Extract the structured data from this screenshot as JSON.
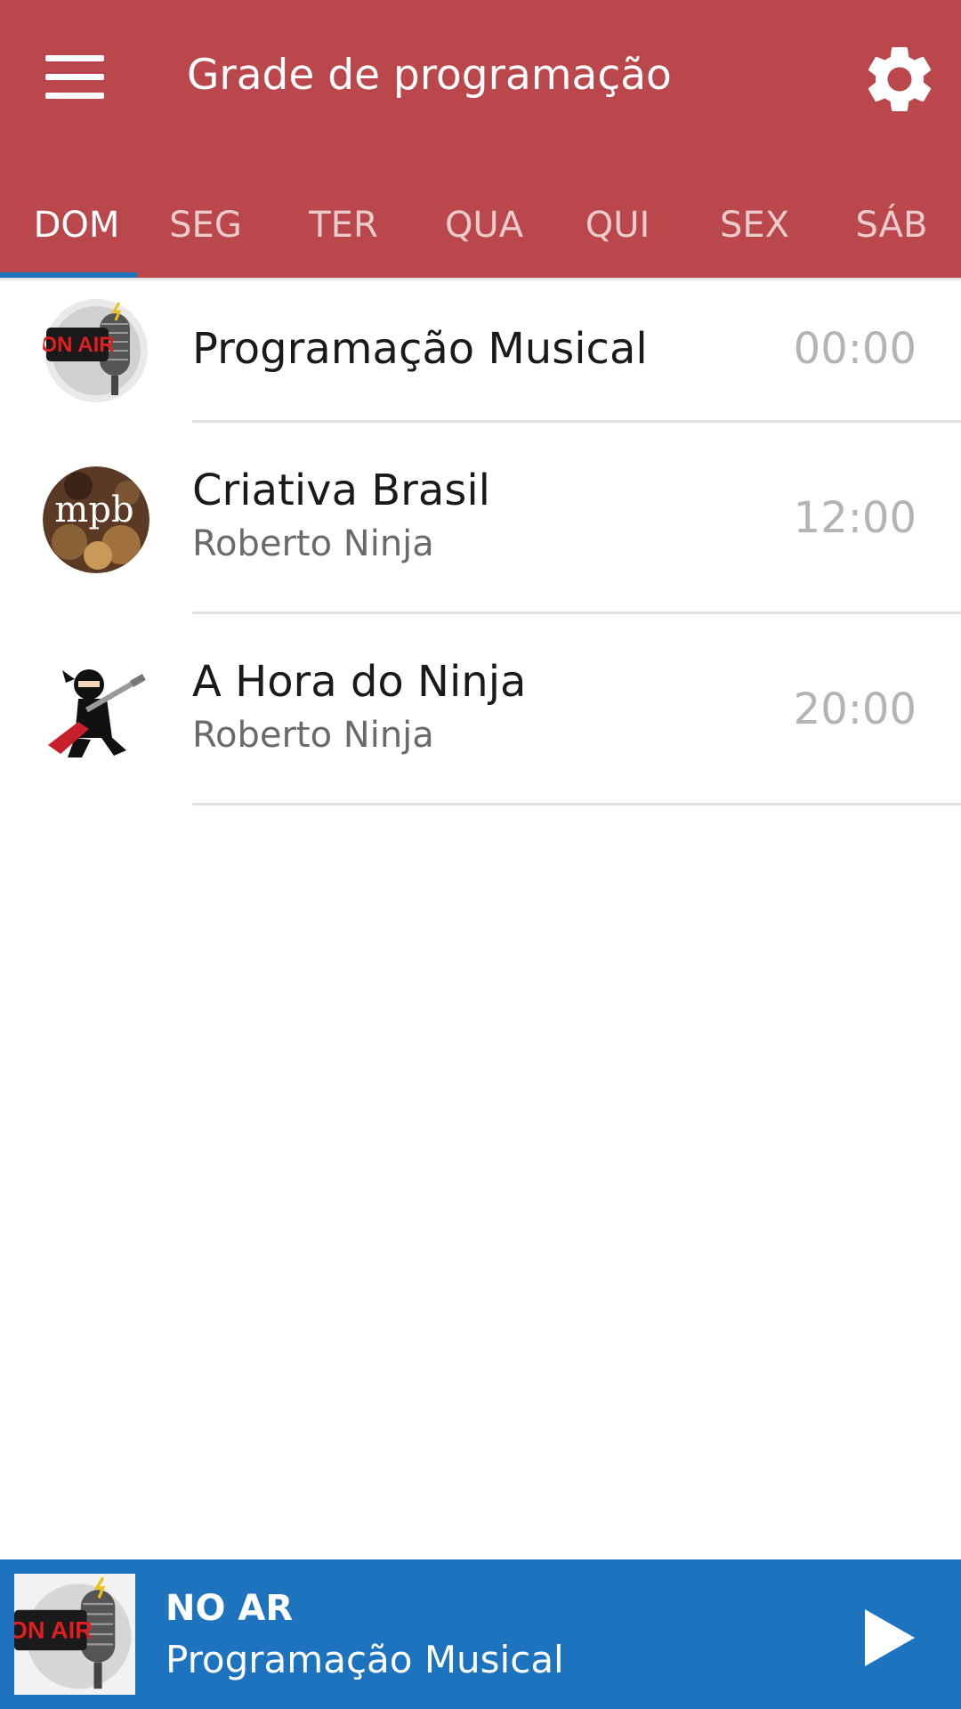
{
  "header": {
    "menu_icon": "hamburger-menu-icon",
    "title": "Grade de programação",
    "settings_icon": "gear-icon",
    "background": "#b9474b"
  },
  "tabs": [
    {
      "label": "DOM",
      "active": true
    },
    {
      "label": "SEG",
      "active": false
    },
    {
      "label": "TER",
      "active": false
    },
    {
      "label": "QUA",
      "active": false
    },
    {
      "label": "QUI",
      "active": false
    },
    {
      "label": "SEX",
      "active": false
    },
    {
      "label": "SÁB",
      "active": false
    }
  ],
  "schedule": [
    {
      "title": "Programação Musical",
      "host": "",
      "time": "00:00",
      "thumb": "on-air-microphone-icon"
    },
    {
      "title": "Criativa Brasil",
      "host": "Roberto Ninja",
      "time": "12:00",
      "thumb": "mpb-logo-icon",
      "thumb_logo_text": "mpb"
    },
    {
      "title": "A Hora do Ninja",
      "host": "Roberto Ninja",
      "time": "20:00",
      "thumb": "ninja-guitar-icon"
    }
  ],
  "player": {
    "label": "NO AR",
    "title": "Programação Musical",
    "thumb": "on-air-microphone-icon",
    "play_icon": "play-icon",
    "background": "#1e73be"
  },
  "colors": {
    "accent": "#1e73be",
    "brand": "#b9474b",
    "time_text": "#b4b4b4"
  }
}
